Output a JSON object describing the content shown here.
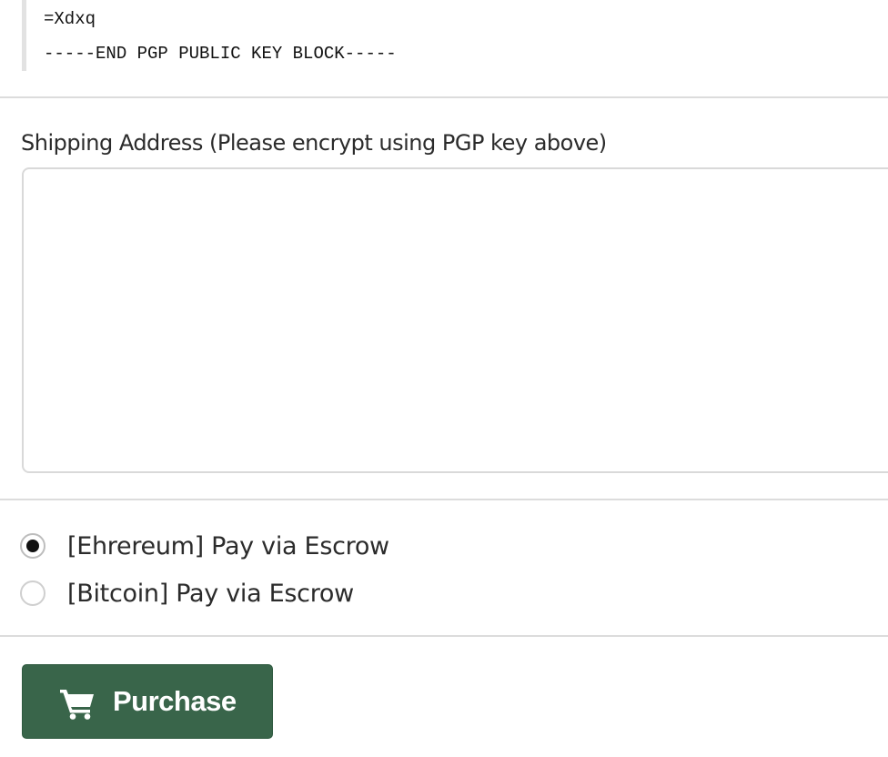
{
  "pgp_key": {
    "checksum_line": "=Xdxq",
    "end_line": "-----END PGP PUBLIC KEY BLOCK-----"
  },
  "shipping": {
    "label": "Shipping Address (Please encrypt using PGP key above)",
    "value": "",
    "placeholder": ""
  },
  "payment_options": [
    {
      "label": "[Ehrereum] Pay via Escrow",
      "selected": true
    },
    {
      "label": "[Bitcoin] Pay via Escrow",
      "selected": false
    }
  ],
  "purchase_button": {
    "label": "Purchase",
    "icon": "shopping-cart-icon",
    "color": "#39654a"
  }
}
